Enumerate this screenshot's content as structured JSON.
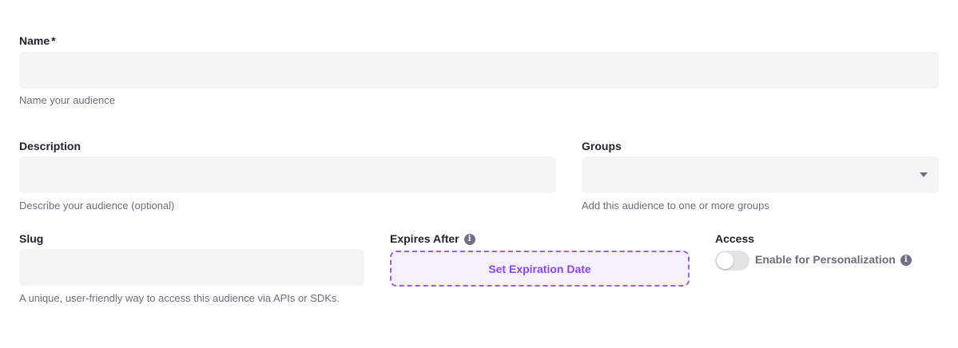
{
  "name": {
    "label": "Name",
    "required_mark": "*",
    "value": "",
    "help": "Name your audience"
  },
  "description": {
    "label": "Description",
    "value": "",
    "help": "Describe your audience (optional)"
  },
  "groups": {
    "label": "Groups",
    "value": "",
    "help": "Add this audience to one or more groups"
  },
  "slug": {
    "label": "Slug",
    "value": "",
    "help": "A unique, user-friendly way to access this audience via APIs or SDKs."
  },
  "expires": {
    "label": "Expires After",
    "button": "Set Expiration Date"
  },
  "access": {
    "label": "Access",
    "toggle_label": "Enable for Personalization",
    "enabled": false
  },
  "info_glyph": "i"
}
